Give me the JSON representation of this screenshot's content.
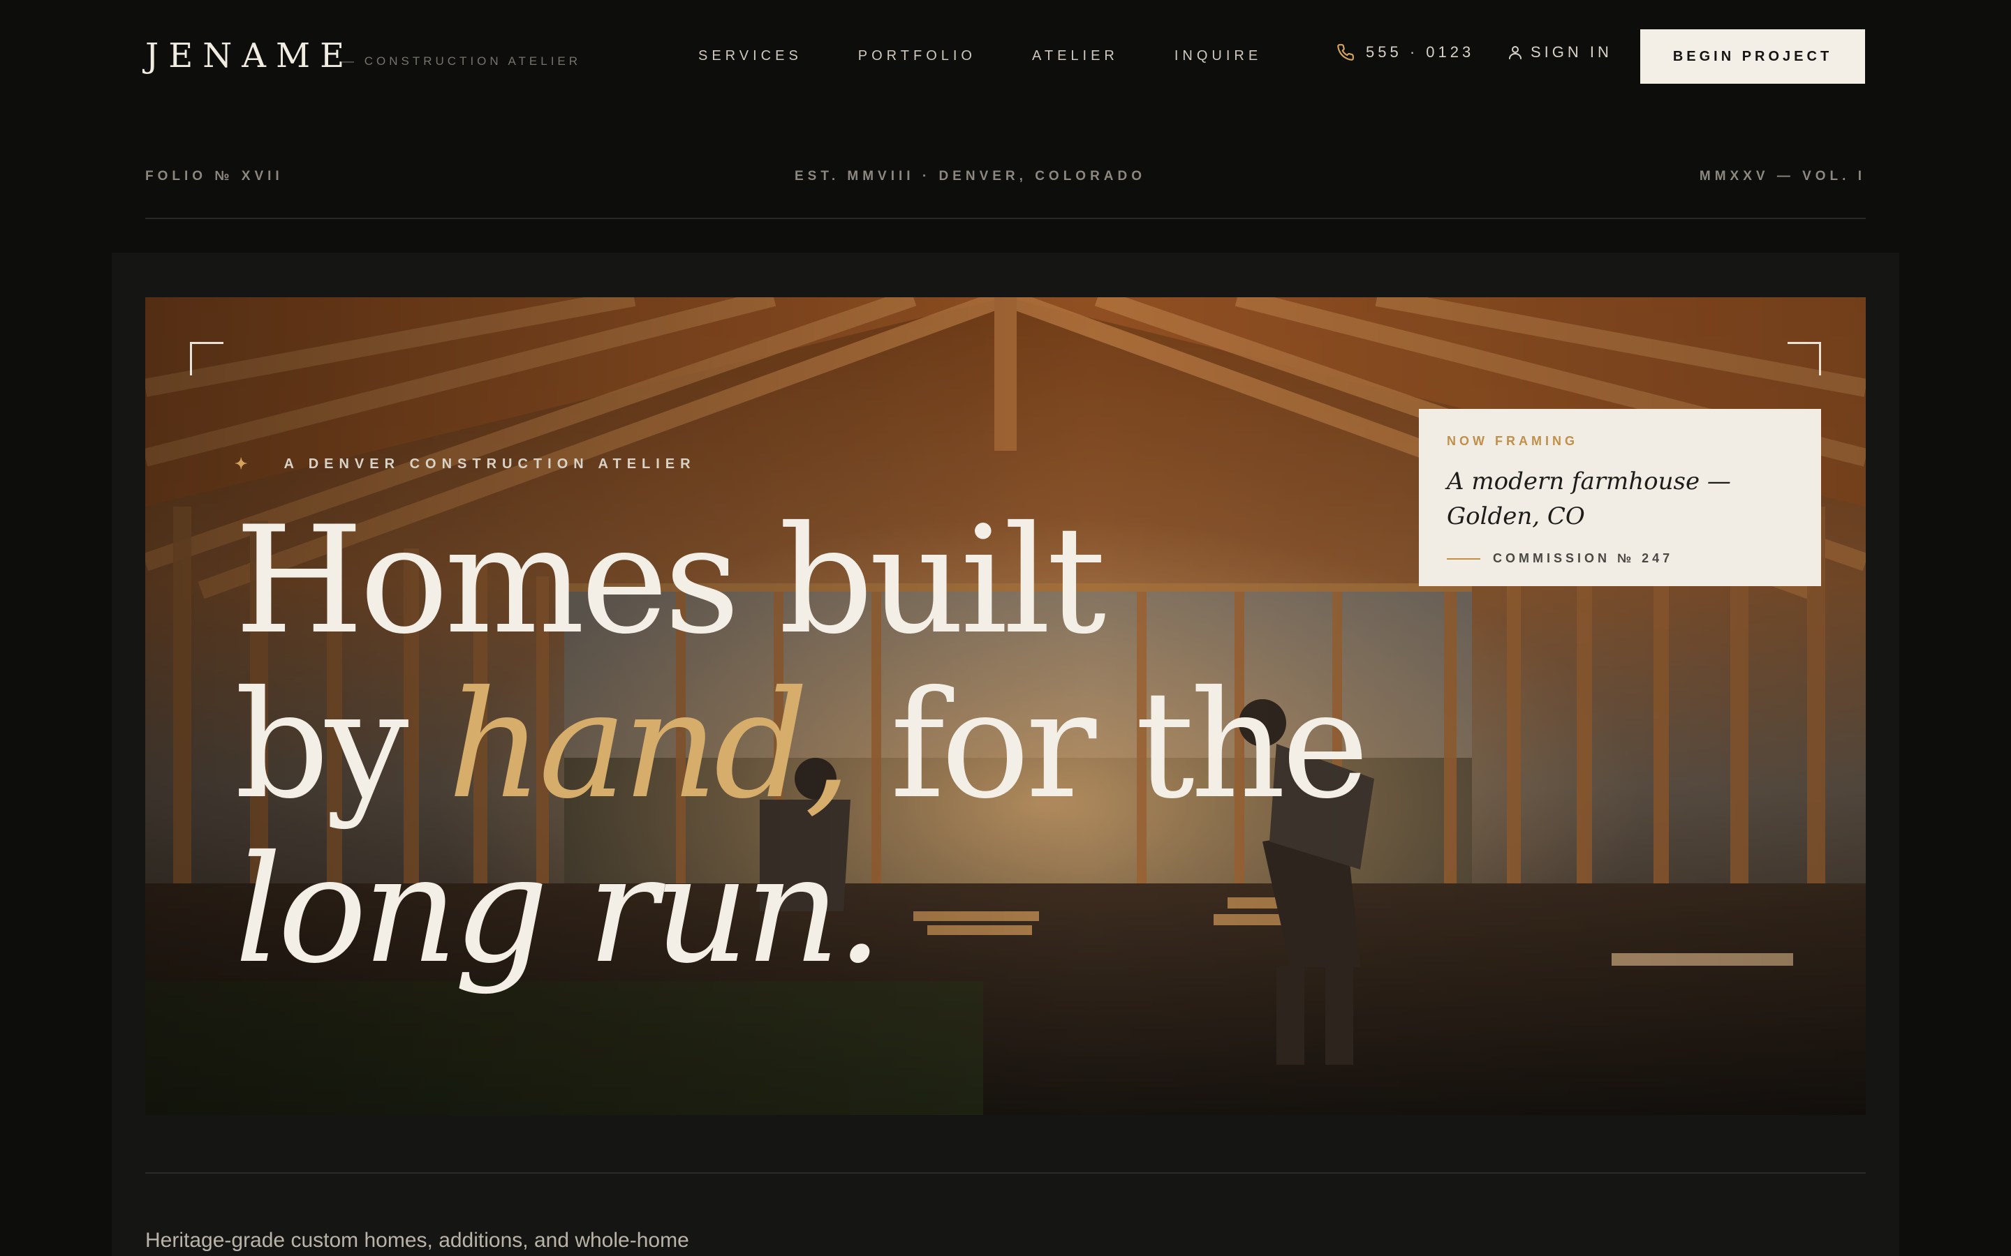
{
  "nav": {
    "brand": "JENAME",
    "brand_sub": "— CONSTRUCTION ATELIER",
    "menu": [
      "SERVICES",
      "PORTFOLIO",
      "ATELIER",
      "INQUIRE"
    ],
    "phone": "555 · 0123",
    "sign_in": "SIGN IN",
    "cta": "BEGIN PROJECT"
  },
  "strip": {
    "left": "FOLIO № XVII",
    "center": "EST. MMVIII · DENVER, COLORADO",
    "right": "MMXXV — VOL. I"
  },
  "hero": {
    "eyebrow": "A DENVER CONSTRUCTION ATELIER",
    "headline": {
      "line1": "Homes built",
      "line2_pre": "by ",
      "line2_accent": "hand,",
      "line2_post": " for the",
      "line3": "long run."
    },
    "card": {
      "kicker": "NOW FRAMING",
      "title": "A modern farmhouse — Golden, CO",
      "commission": "COMMISSION № 247"
    }
  },
  "intro": "Heritage-grade custom homes, additions, and whole-home",
  "colors": {
    "accent": "#d6ad6b",
    "background": "#0d0d0c",
    "panel": "#151513",
    "cta_bg": "#f3efe7"
  },
  "icons": {
    "phone": "phone-icon",
    "user": "user-icon",
    "sparkle": "sparkle-icon"
  }
}
